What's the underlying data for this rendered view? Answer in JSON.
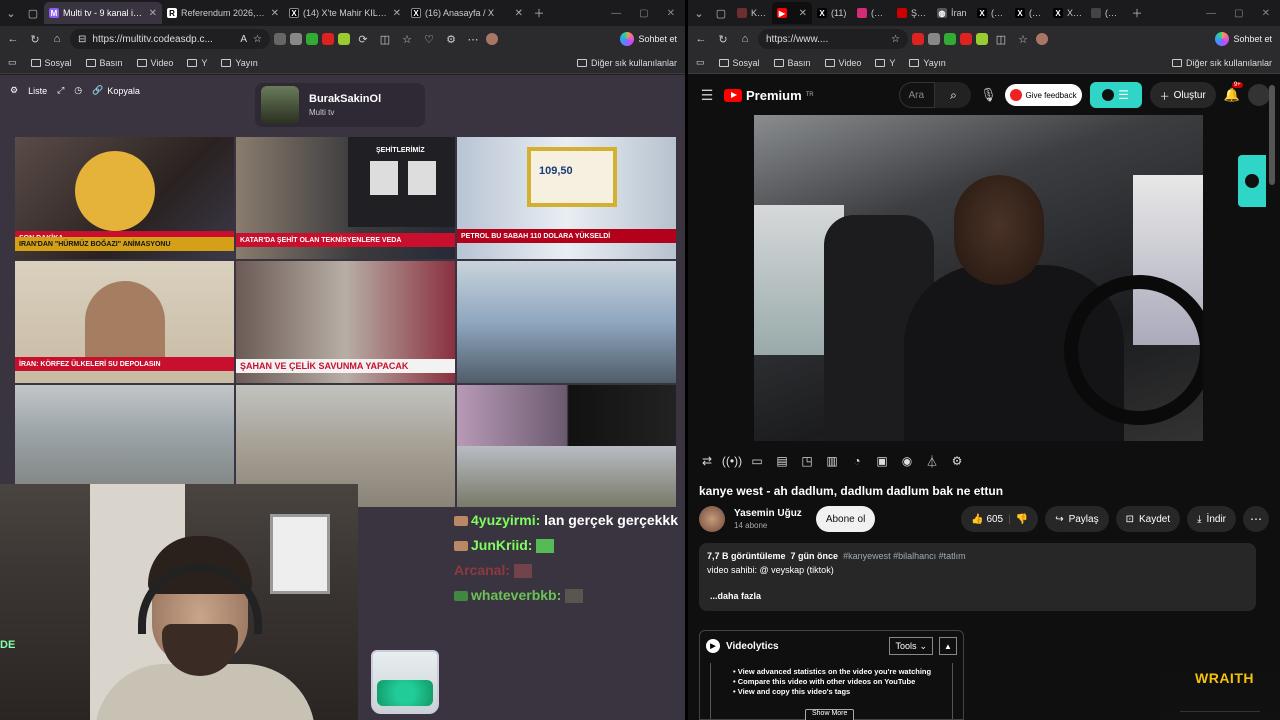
{
  "left_window": {
    "tabs": [
      {
        "title": "Multi tv - 9 kanal izleni",
        "active": true,
        "favicon_color": "#8b5cf6"
      },
      {
        "title": "Referendum 2026, oggi",
        "active": false,
        "favicon_color": "#ffffff"
      },
      {
        "title": "(14) X'te Mahir KILIÇ: \"C",
        "active": false,
        "favicon_color": "#000000"
      },
      {
        "title": "(16) Anasayfa / X",
        "active": false,
        "favicon_color": "#000000"
      }
    ],
    "url": "https://multitv.codeasdp.c...",
    "copilot_label": "Sohbet et",
    "bookmarks": [
      "Sosyal",
      "Basın",
      "Video",
      "Y",
      "Yayın"
    ],
    "other_bookmarks": "Diğer sık kullanılanlar"
  },
  "multitv": {
    "toolbar": {
      "list_label": "Liste",
      "copy_label": "Kopyala"
    },
    "channel": {
      "name": "BurakSakinOl",
      "subtitle": "Multi tv"
    },
    "tiles": [
      {
        "caption": "IRAN'DAN \"HÜRMÜZ BOĞAZI\" ANİMASYONU",
        "top": "SON DAKİKA",
        "color": "#d4a017"
      },
      {
        "caption": "KATAR'DA ŞEHİT OLAN TEKNİSYENLERE VEDA",
        "top": "ŞEHİTLERİMİZ",
        "color": "#c8102e"
      },
      {
        "caption": "PETROL BU SABAH 110 DOLARA YÜKSELDİ",
        "top": "109,50",
        "color": "#b3001b"
      },
      {
        "caption": "İRAN: KÖRFEZ ÜLKELERİ SU DEPOLASIN",
        "top": "",
        "color": "#c8102e"
      },
      {
        "caption": "ŞAHAN VE ÇELİK SAVUNMA YAPACAK",
        "top": "",
        "color": "#e8e8e8"
      },
      {
        "caption": "",
        "top": "",
        "color": "#8fa7bf"
      },
      {
        "caption": "",
        "top": "",
        "color": "#9aa3a8"
      },
      {
        "caption": "",
        "top": "",
        "color": "#a6a095"
      },
      {
        "caption": "",
        "top": "",
        "color": "#6b6a8a"
      }
    ]
  },
  "chat": [
    {
      "user": "4yuzyirmi:",
      "msg": "lan gerçek gerçekkk",
      "color": "#7fff5f"
    },
    {
      "user": "JunKriid:",
      "msg": "",
      "color": "#7fff5f"
    },
    {
      "user": "Arcanal:",
      "msg": "",
      "color": "#e04040"
    },
    {
      "user": "whateverbkb:",
      "msg": "",
      "color": "#7fff5f"
    }
  ],
  "webcam": {
    "overlay_text": "DE"
  },
  "right_window": {
    "tabs": [
      "Kick",
      "",
      "(11)",
      "(9) In",
      "Şanlı",
      "İran",
      "(11)",
      "(9) B",
      "X'te",
      "(2) In"
    ],
    "url": "https://www....",
    "copilot_label": "Sohbet et",
    "bookmarks": [
      "Sosyal",
      "Basın",
      "Video",
      "Y",
      "Yayın"
    ],
    "other_bookmarks": "Diğer sık kullanılanlar"
  },
  "youtube": {
    "logo": "Premium",
    "region": "TR",
    "search_placeholder": "Ara",
    "feedback_label": "Give feedback",
    "create_label": "Oluştur",
    "notifications": "9+",
    "video_title": "kanye west - ah dadlum, dadlum dadlum bak ne ettun",
    "channel_name": "Yasemin Uğuz",
    "subscribers": "14 abone",
    "subscribe_label": "Abone ol",
    "likes": "605",
    "share_label": "Paylaş",
    "save_label": "Kaydet",
    "download_label": "İndir",
    "views": "7,7 B görüntüleme",
    "age": "7 gün önce",
    "tags": "#kanyewest #bilalhancı #tatlım",
    "description": "video sahibi: @ veyskap (tiktok)",
    "more_label": "...daha fazla",
    "videolytics": {
      "title": "Videolytics",
      "tools_label": "Tools",
      "items": [
        "View advanced statistics on the video you're watching",
        "Compare this video with other videos on YouTube",
        "View and copy this video's tags"
      ],
      "show_label": "Show More"
    }
  },
  "overlay_brand": "WRAITH",
  "colors": {
    "yt_red": "#ff0000",
    "teal": "#2fd6c8",
    "chat_green": "#7fff5f",
    "wraith_yellow": "#f5c20a"
  }
}
